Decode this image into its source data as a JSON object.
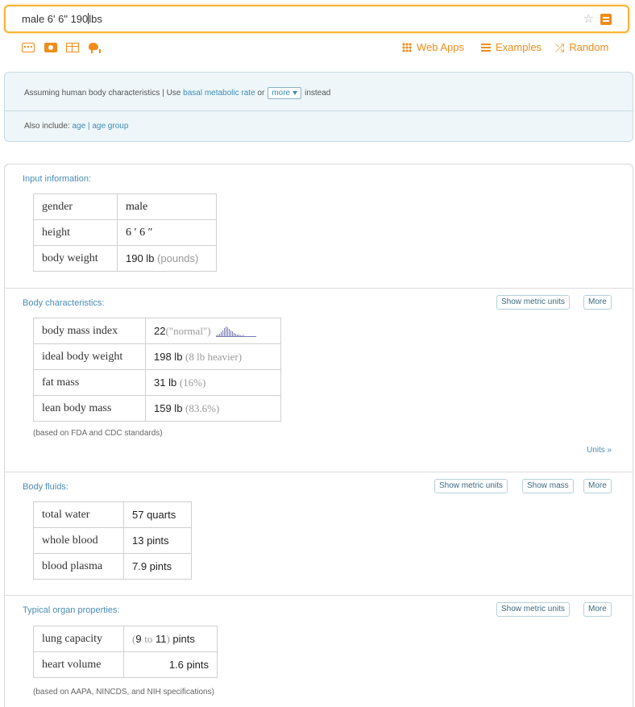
{
  "search": {
    "query_before_caret": "male 6' 6\" 190",
    "query_after_caret": "lbs"
  },
  "toolbar": {
    "icons": [
      "keyboard-icon",
      "camera-icon",
      "table-icon",
      "pet-icon"
    ],
    "web_apps": "Web Apps",
    "examples": "Examples",
    "random": "Random"
  },
  "colors": {
    "accent": "#f08c1a",
    "link": "#3d8cba",
    "pod_title": "#4a8cb5",
    "search_border": "#f5b536"
  },
  "assumptions": {
    "prefix": "Assuming human body characteristics | Use",
    "alt_link": "basal metabolic rate",
    "or": "or",
    "more_label": "more",
    "suffix": "instead",
    "also_include": "Also include:",
    "age": "age",
    "sep": "|",
    "age_group": "age group"
  },
  "pods": {
    "input": {
      "title": "Input information:",
      "rows": [
        {
          "label": "gender",
          "value": "male"
        },
        {
          "label": "height",
          "value": "6 ′  6 ″"
        },
        {
          "label": "body weight",
          "value": "190 lb",
          "extra": "(pounds)"
        }
      ]
    },
    "body": {
      "title": "Body characteristics:",
      "btn_metric": "Show metric units",
      "btn_more": "More",
      "rows": [
        {
          "label": "body mass index",
          "value": "22",
          "extra": "(\"normal\")"
        },
        {
          "label": "ideal body weight",
          "value": "198 lb",
          "extra": "(8 lb heavier)"
        },
        {
          "label": "fat mass",
          "value": "31 lb",
          "extra": "(16%)"
        },
        {
          "label": "lean body mass",
          "value": "159 lb",
          "extra": "(83.6%)"
        }
      ],
      "bmi_histogram": [
        1,
        2,
        3,
        5,
        8,
        11,
        13,
        12,
        10,
        8,
        6,
        4,
        3,
        2,
        2,
        1,
        1,
        1
      ],
      "note": "(based on FDA and CDC standards)",
      "units_link": "Units »"
    },
    "fluids": {
      "title": "Body fluids:",
      "btn_metric": "Show metric units",
      "btn_mass": "Show mass",
      "btn_more": "More",
      "rows": [
        {
          "label": "total water",
          "value": "57 quarts"
        },
        {
          "label": "whole blood",
          "value": "13 pints"
        },
        {
          "label": "blood plasma",
          "value": "7.9 pints"
        }
      ]
    },
    "organ": {
      "title": "Typical organ properties:",
      "btn_metric": "Show metric units",
      "btn_more": "More",
      "rows": [
        {
          "label": "lung capacity",
          "open": "(",
          "low": "9",
          "to": "to",
          "high": "11",
          "close": ")",
          "unit": "pints"
        },
        {
          "label": "heart volume",
          "value": "1.6 pints"
        }
      ],
      "note": "(based on AAPA, NINCDS, and NIH specifications)"
    }
  }
}
